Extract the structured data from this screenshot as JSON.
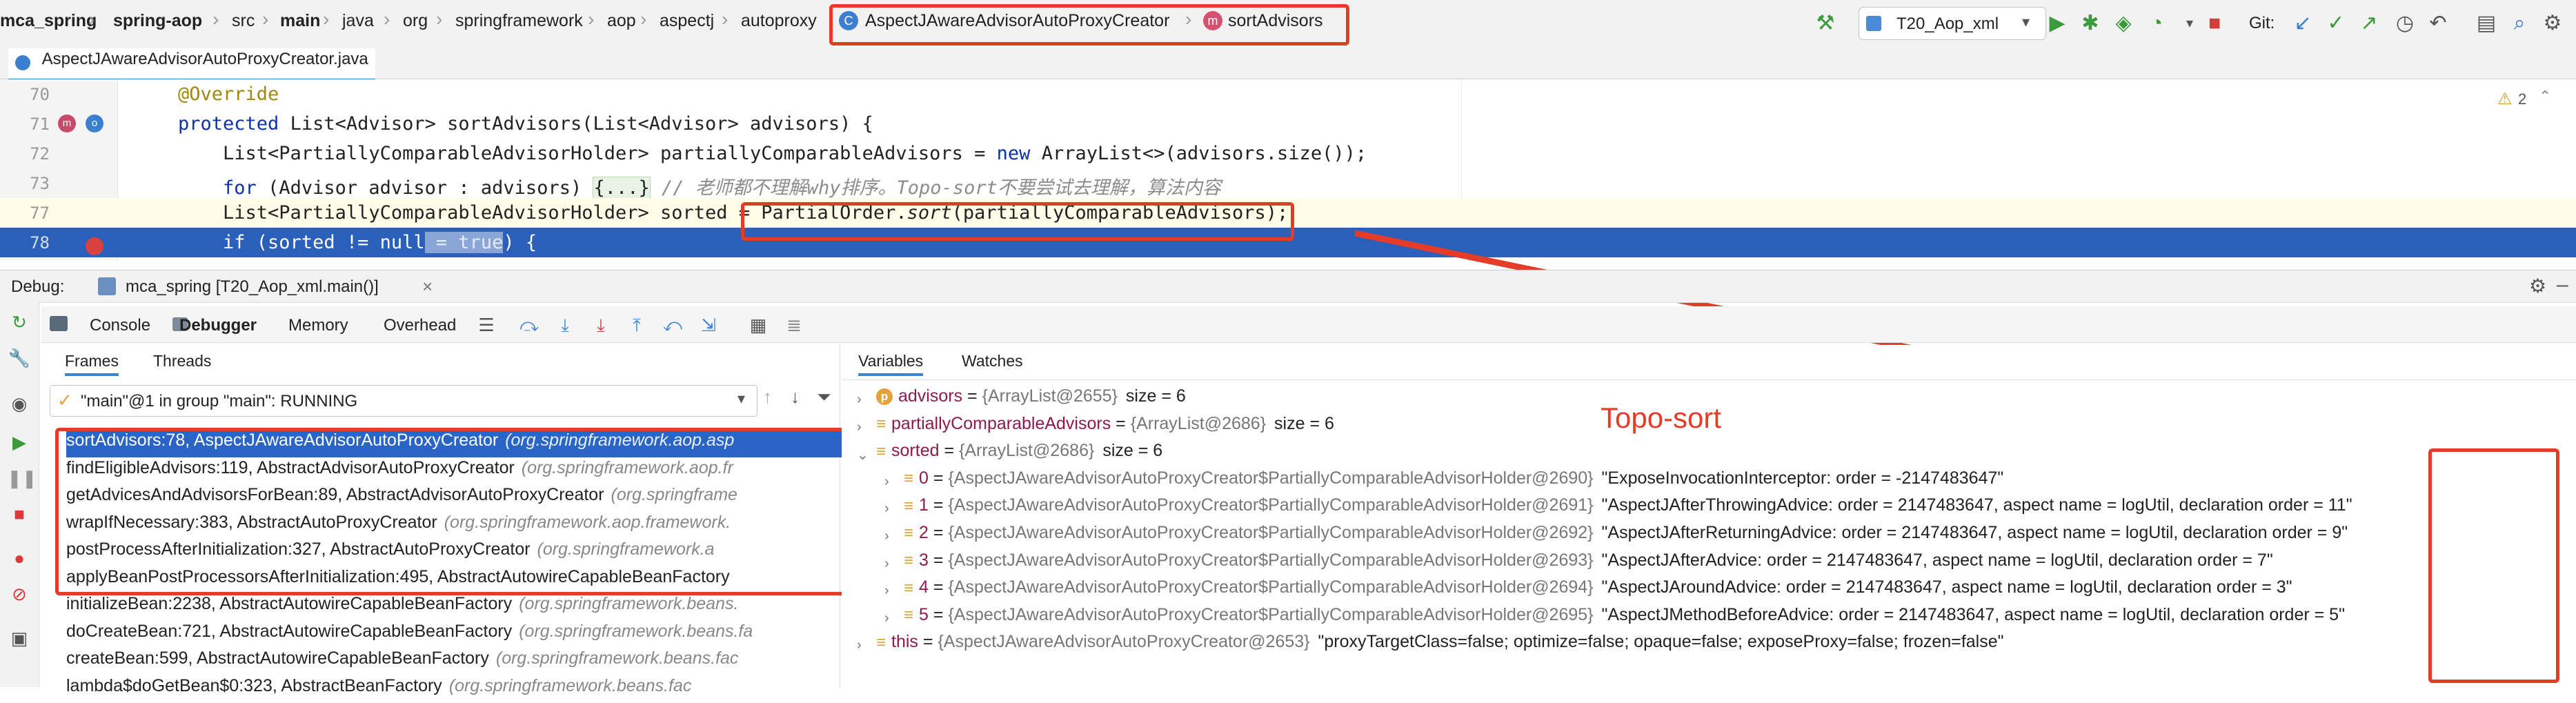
{
  "breadcrumb": [
    "mca_spring",
    "spring-aop",
    "src",
    "main",
    "java",
    "org",
    "springframework",
    "aop",
    "aspectj",
    "autoproxy",
    "AspectJAwareAdvisorAutoProxyCreator",
    "sortAdvisors"
  ],
  "toolbar": {
    "run_config": "T20_Aop_xml",
    "git_label": "Git:"
  },
  "file_tab": "AspectJAwareAdvisorAutoProxyCreator.java",
  "editor": {
    "warning_count": "2",
    "lines": [
      {
        "num": "70",
        "parts": [
          {
            "t": "@Override",
            "c": "ann"
          }
        ]
      },
      {
        "num": "71",
        "parts": [
          {
            "t": "protected ",
            "c": "kw"
          },
          {
            "t": "List<Advisor> sortAdvisors(List<Advisor> advisors) {",
            "c": ""
          }
        ]
      },
      {
        "num": "72",
        "parts": [
          {
            "t": "    List<PartiallyComparableAdvisorHolder> partiallyComparableAdvisors = ",
            "c": ""
          },
          {
            "t": "new ",
            "c": "kw"
          },
          {
            "t": "ArrayList<>(advisors.size());",
            "c": ""
          }
        ]
      },
      {
        "num": "73",
        "parts": [
          {
            "t": "    ",
            "c": ""
          },
          {
            "t": "for ",
            "c": "kw"
          },
          {
            "t": "(Advisor advisor : advisors) ",
            "c": ""
          },
          {
            "t": "{...}",
            "c": "fold"
          },
          {
            "t": " // 老师都不理解why排序。Topo-sort不要尝试去理解，算法内容",
            "c": "cmt"
          }
        ]
      },
      {
        "num": "77",
        "parts": [
          {
            "t": "    List<PartiallyComparableAdvisorHolder> sorted = PartialOrder.",
            "c": ""
          },
          {
            "t": "sort",
            "c": "cmt"
          },
          {
            "t": "(partiallyComparableAdvisors);",
            "c": ""
          }
        ]
      },
      {
        "num": "78",
        "parts": [
          {
            "t": "    if (sorted != null",
            "c": ""
          },
          {
            "t": " = true",
            "c": ""
          },
          {
            "t": ") {",
            "c": ""
          }
        ]
      }
    ]
  },
  "debug": {
    "label": "Debug:",
    "session": "mca_spring [T20_Aop_xml.main()]",
    "tabs": [
      "Console",
      "Debugger",
      "Memory",
      "Overhead"
    ],
    "frames_tab": "Frames",
    "threads_tab": "Threads",
    "thread": "\"main\"@1 in group \"main\": RUNNING",
    "frames": [
      {
        "method": "sortAdvisors:78, AspectJAwareAdvisorAutoProxyCreator",
        "pkg": "(org.springframework.aop.asp"
      },
      {
        "method": "findEligibleAdvisors:119, AbstractAdvisorAutoProxyCreator",
        "pkg": "(org.springframework.aop.fr"
      },
      {
        "method": "getAdvicesAndAdvisorsForBean:89, AbstractAdvisorAutoProxyCreator",
        "pkg": "(org.springframe"
      },
      {
        "method": "wrapIfNecessary:383, AbstractAutoProxyCreator",
        "pkg": "(org.springframework.aop.framework."
      },
      {
        "method": "postProcessAfterInitialization:327, AbstractAutoProxyCreator",
        "pkg": "(org.springframework.a"
      },
      {
        "method": "applyBeanPostProcessorsAfterInitialization:495, AbstractAutowireCapableBeanFactory",
        "pkg": ""
      },
      {
        "method": "initializeBean:2238, AbstractAutowireCapableBeanFactory",
        "pkg": "(org.springframework.beans."
      },
      {
        "method": "doCreateBean:721, AbstractAutowireCapableBeanFactory",
        "pkg": "(org.springframework.beans.fa"
      },
      {
        "method": "createBean:599, AbstractAutowireCapableBeanFactory",
        "pkg": "(org.springframework.beans.fac"
      },
      {
        "method": "lambda$doGetBean$0:323, AbstractBeanFactory",
        "pkg": "(org.springframework.beans.fac"
      }
    ],
    "variables_tab": "Variables",
    "watches_tab": "Watches",
    "variables": [
      {
        "icon": "p",
        "name": "advisors",
        "value": "{ArrayList@2655}",
        "extra": "size = 6",
        "indent": 0
      },
      {
        "icon": "lines",
        "name": "partiallyComparableAdvisors",
        "value": "{ArrayList@2686}",
        "extra": "size = 6",
        "indent": 0
      },
      {
        "icon": "lines",
        "name": "sorted",
        "value": "{ArrayList@2686}",
        "extra": "size = 6",
        "indent": 0
      },
      {
        "icon": "lines",
        "name": "0",
        "value": "{AspectJAwareAdvisorAutoProxyCreator$PartiallyComparableAdvisorHolder@2690}",
        "extra": "\"ExposeInvocationInterceptor: order = -2147483647\"",
        "indent": 1
      },
      {
        "icon": "lines",
        "name": "1",
        "value": "{AspectJAwareAdvisorAutoProxyCreator$PartiallyComparableAdvisorHolder@2691}",
        "extra": "\"AspectJAfterThrowingAdvice: order = 2147483647, aspect name = logUtil, declaration order = 11\"",
        "indent": 1
      },
      {
        "icon": "lines",
        "name": "2",
        "value": "{AspectJAwareAdvisorAutoProxyCreator$PartiallyComparableAdvisorHolder@2692}",
        "extra": "\"AspectJAfterReturningAdvice: order = 2147483647, aspect name = logUtil, declaration order = 9\"",
        "indent": 1
      },
      {
        "icon": "lines",
        "name": "3",
        "value": "{AspectJAwareAdvisorAutoProxyCreator$PartiallyComparableAdvisorHolder@2693}",
        "extra": "\"AspectJAfterAdvice: order = 2147483647, aspect name = logUtil, declaration order = 7\"",
        "indent": 1
      },
      {
        "icon": "lines",
        "name": "4",
        "value": "{AspectJAwareAdvisorAutoProxyCreator$PartiallyComparableAdvisorHolder@2694}",
        "extra": "\"AspectJAroundAdvice: order = 2147483647, aspect name = logUtil, declaration order = 3\"",
        "indent": 1
      },
      {
        "icon": "lines",
        "name": "5",
        "value": "{AspectJAwareAdvisorAutoProxyCreator$PartiallyComparableAdvisorHolder@2695}",
        "extra": "\"AspectJMethodBeforeAdvice: order = 2147483647, aspect name = logUtil, declaration order = 5\"",
        "indent": 1
      },
      {
        "icon": "lines",
        "name": "this",
        "value": "{AspectJAwareAdvisorAutoProxyCreator@2653}",
        "extra": "\"proxyTargetClass=false; optimize=false; opaque=false; exposeProxy=false; frozen=false\"",
        "indent": 0
      }
    ]
  },
  "annotation": {
    "topo_label": "Topo-sort",
    "color": "#e43c28"
  },
  "colors": {
    "selection": "#2a65c6",
    "current_line": "#2a5fba",
    "accent": "#4083c9"
  }
}
